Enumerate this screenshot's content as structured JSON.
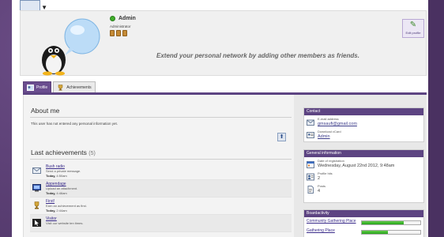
{
  "profile": {
    "username": "Admin",
    "role": "Administrator",
    "edit_label": "Edit profile",
    "extend_message": "Extend your personal network by adding other members as friends.",
    "online_color": "#3fae2a"
  },
  "tabs": [
    {
      "label": "Profile",
      "active": true,
      "icon": "profile-icon"
    },
    {
      "label": "Achievements",
      "active": false,
      "icon": "trophy-icon"
    }
  ],
  "about": {
    "title": "About me",
    "text": "This user has not entered any personal information yet."
  },
  "achievements": {
    "title": "Last achievements",
    "count": "(5)",
    "items": [
      {
        "name": "Bush radio",
        "desc": "Send a private message.",
        "date_label": "Today,",
        "time": "4:50am",
        "icon": "envelope-icon"
      },
      {
        "name": "Appendage",
        "desc": "Upload an attachment.",
        "date_label": "Today,",
        "time": "4:46am",
        "icon": "monitor-icon"
      },
      {
        "name": "First!",
        "desc": "Earn an achievement as first.",
        "date_label": "Today,",
        "time": "2:44am",
        "icon": "trophy-icon"
      },
      {
        "name": "Visitor",
        "desc": "Visit our website ten times.",
        "date_label": "",
        "time": "",
        "icon": "cursor-icon"
      }
    ]
  },
  "sidebar": {
    "contact": {
      "title": "Contact",
      "email_label": "E-mail address",
      "email_value": "gmsaufi@gmail.com",
      "vcard_label": "Download vCard",
      "vcard_value": "Admin"
    },
    "general": {
      "title": "General information",
      "registration_label": "Date of registration",
      "registration_value": "Wednesday, August 22nd 2012, 9:48am",
      "profile_hits_label": "Profile hits",
      "profile_hits_value": "2",
      "posts_label": "Posts",
      "posts_value": "4"
    },
    "boardactivity": {
      "title": "Boardactivity",
      "items": [
        {
          "name": "Community Gathering Place",
          "level": 0.72
        },
        {
          "name": "Gathering Place",
          "level": 0.45
        }
      ]
    }
  },
  "colors": {
    "accent": "#5d4482",
    "link": "#3a2c8a",
    "bar": "#25a41a"
  }
}
